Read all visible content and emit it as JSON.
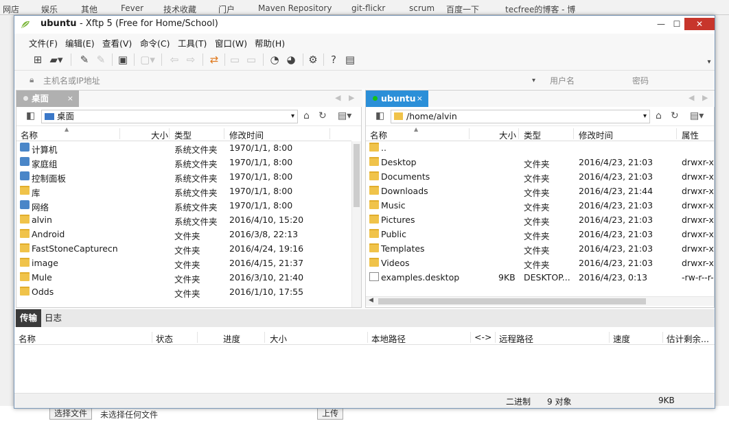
{
  "browser": {
    "bookmarks": [
      "网店",
      "娱乐",
      "其他",
      "Fever",
      "技术收藏",
      "门户",
      "Maven Repository",
      "git-flickr",
      "scrum",
      "百度一下",
      "tecfree的博客 - 博"
    ]
  },
  "window": {
    "title_host": "ubuntu",
    "title_app": "- Xftp 5 (Free for Home/School)",
    "controls": {
      "minimize": "—",
      "maximize": "☐",
      "close": "✕"
    }
  },
  "menu": [
    "文件(F)",
    "编辑(E)",
    "查看(V)",
    "命令(C)",
    "工具(T)",
    "窗口(W)",
    "帮助(H)"
  ],
  "address": {
    "host_placeholder": "主机名或IP地址",
    "user_placeholder": "用户名",
    "pass_placeholder": "密码"
  },
  "colors": {
    "accent": "#2b8fd8",
    "connected": "#14c114",
    "close": "#c7352b"
  },
  "local": {
    "tab": "桌面",
    "path": "桌面",
    "columns": [
      "名称",
      "大小",
      "类型",
      "修改时间"
    ],
    "files": [
      {
        "name": "计算机",
        "size": "",
        "type": "系统文件夹",
        "modified": "1970/1/1, 8:00",
        "icon": "computer-icon"
      },
      {
        "name": "家庭组",
        "size": "",
        "type": "系统文件夹",
        "modified": "1970/1/1, 8:00",
        "icon": "homegroup-icon"
      },
      {
        "name": "控制面板",
        "size": "",
        "type": "系统文件夹",
        "modified": "1970/1/1, 8:00",
        "icon": "control-panel-icon"
      },
      {
        "name": "库",
        "size": "",
        "type": "系统文件夹",
        "modified": "1970/1/1, 8:00",
        "icon": "library-icon"
      },
      {
        "name": "网络",
        "size": "",
        "type": "系统文件夹",
        "modified": "1970/1/1, 8:00",
        "icon": "network-icon"
      },
      {
        "name": "alvin",
        "size": "",
        "type": "系统文件夹",
        "modified": "2016/4/10, 15:20",
        "icon": "user-folder-icon"
      },
      {
        "name": "Android",
        "size": "",
        "type": "文件夹",
        "modified": "2016/3/8, 22:13",
        "icon": "folder-icon"
      },
      {
        "name": "FastStoneCapturecn",
        "size": "",
        "type": "文件夹",
        "modified": "2016/4/24, 19:16",
        "icon": "folder-icon"
      },
      {
        "name": "image",
        "size": "",
        "type": "文件夹",
        "modified": "2016/4/15, 21:37",
        "icon": "folder-icon"
      },
      {
        "name": "Mule",
        "size": "",
        "type": "文件夹",
        "modified": "2016/3/10, 21:40",
        "icon": "folder-icon"
      },
      {
        "name": "Odds",
        "size": "",
        "type": "文件夹",
        "modified": "2016/1/10, 17:55",
        "icon": "folder-icon"
      }
    ]
  },
  "remote": {
    "tab": "ubuntu",
    "path": "/home/alvin",
    "columns": [
      "名称",
      "大小",
      "类型",
      "修改时间",
      "属性"
    ],
    "files": [
      {
        "name": "..",
        "size": "",
        "type": "",
        "modified": "",
        "attr": "",
        "icon": "folder-icon"
      },
      {
        "name": "Desktop",
        "size": "",
        "type": "文件夹",
        "modified": "2016/4/23, 21:03",
        "attr": "drwxr-xr",
        "icon": "folder-icon"
      },
      {
        "name": "Documents",
        "size": "",
        "type": "文件夹",
        "modified": "2016/4/23, 21:03",
        "attr": "drwxr-xr",
        "icon": "folder-icon"
      },
      {
        "name": "Downloads",
        "size": "",
        "type": "文件夹",
        "modified": "2016/4/23, 21:44",
        "attr": "drwxr-xr",
        "icon": "folder-icon"
      },
      {
        "name": "Music",
        "size": "",
        "type": "文件夹",
        "modified": "2016/4/23, 21:03",
        "attr": "drwxr-xr",
        "icon": "folder-icon"
      },
      {
        "name": "Pictures",
        "size": "",
        "type": "文件夹",
        "modified": "2016/4/23, 21:03",
        "attr": "drwxr-xr",
        "icon": "folder-icon"
      },
      {
        "name": "Public",
        "size": "",
        "type": "文件夹",
        "modified": "2016/4/23, 21:03",
        "attr": "drwxr-xr",
        "icon": "folder-icon"
      },
      {
        "name": "Templates",
        "size": "",
        "type": "文件夹",
        "modified": "2016/4/23, 21:03",
        "attr": "drwxr-xr",
        "icon": "folder-icon"
      },
      {
        "name": "Videos",
        "size": "",
        "type": "文件夹",
        "modified": "2016/4/23, 21:03",
        "attr": "drwxr-xr",
        "icon": "folder-icon"
      },
      {
        "name": "examples.desktop",
        "size": "9KB",
        "type": "DESKTOP...",
        "modified": "2016/4/23, 0:13",
        "attr": "-rw-r--r-",
        "icon": "file-icon"
      }
    ]
  },
  "transfer": {
    "tabs": [
      "传输",
      "日志"
    ],
    "columns": [
      "名称",
      "状态",
      "进度",
      "大小",
      "本地路径",
      "<->",
      "远程路径",
      "速度",
      "估计剩余..."
    ]
  },
  "status": {
    "mode": "二进制",
    "count": "9 对象",
    "size": "9KB"
  },
  "page_below": {
    "choose_file": "选择文件",
    "no_file": "未选择任何文件",
    "upload": "上传"
  }
}
